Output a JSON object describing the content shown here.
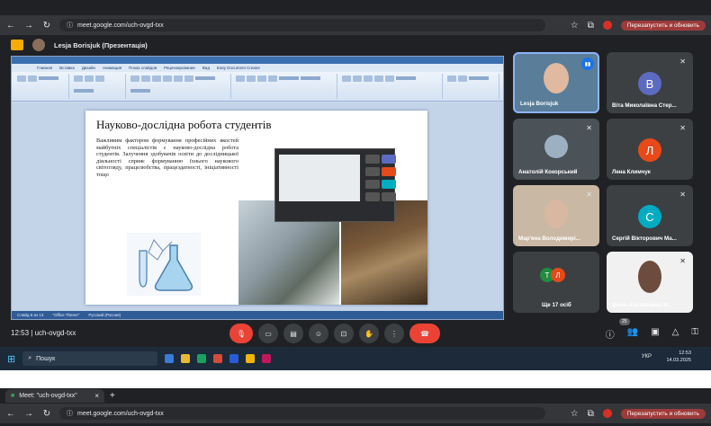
{
  "window1": {
    "url": "meet.google.com/uch-ovgd-txx",
    "relaunch_label": "Перезапустить и обновить",
    "presenting": "Lesja Borisjuk (Презентація)",
    "slide": {
      "title": "Науково-дослідна робота студентів",
      "text": "Важливим фактором формування професійних якостей майбутніх спеціалістів є науково-дослідна робота студентів. Залучення здобувачів освіти до дослідницької діяльності сприяє формуванню їхнього наукового світогляду, працелюбства, працездатності, ініціативності тощо"
    },
    "ribbon_tabs": [
      "Главная",
      "Вставка",
      "Дизайн",
      "Анимация",
      "Показ слайдов",
      "Рецензирование",
      "Вид",
      "Easy Document Creator"
    ],
    "status_items": [
      "Слайд 6 из 13",
      "\"Office Theme\"",
      "Русский (Россия)"
    ],
    "participants": [
      {
        "name": "Lesja Borisjuk",
        "type": "video",
        "speaking": true
      },
      {
        "name": "Віта Миколаївна Стер...",
        "type": "letter",
        "letter": "В",
        "color": "#5c6bc0"
      },
      {
        "name": "Анатолій Кокорський",
        "type": "video"
      },
      {
        "name": "Лена Климчук",
        "type": "letter",
        "letter": "Л",
        "color": "#e64a19"
      },
      {
        "name": "Мар'яна Володимирі...",
        "type": "video"
      },
      {
        "name": "Сергій Вікторович Ма...",
        "type": "letter",
        "letter": "С",
        "color": "#00acc1"
      },
      {
        "name": "Ще 17 осіб",
        "type": "others"
      },
      {
        "name": "Ірина Анатоліївна Ж...",
        "type": "video"
      }
    ],
    "meeting_time": "12:53",
    "meeting_code": "uch-ovgd-txx",
    "participants_count": "25",
    "taskbar_search": "Пошук",
    "tray_lang": "УКР",
    "clock_time": "12:53",
    "clock_date": "14.03.2025"
  },
  "window2": {
    "tab_title": "Meet: \"uch-ovgd-txx\"",
    "url": "meet.google.com/uch-ovgd-txx",
    "relaunch_label": "Перезапустить и обновить"
  }
}
